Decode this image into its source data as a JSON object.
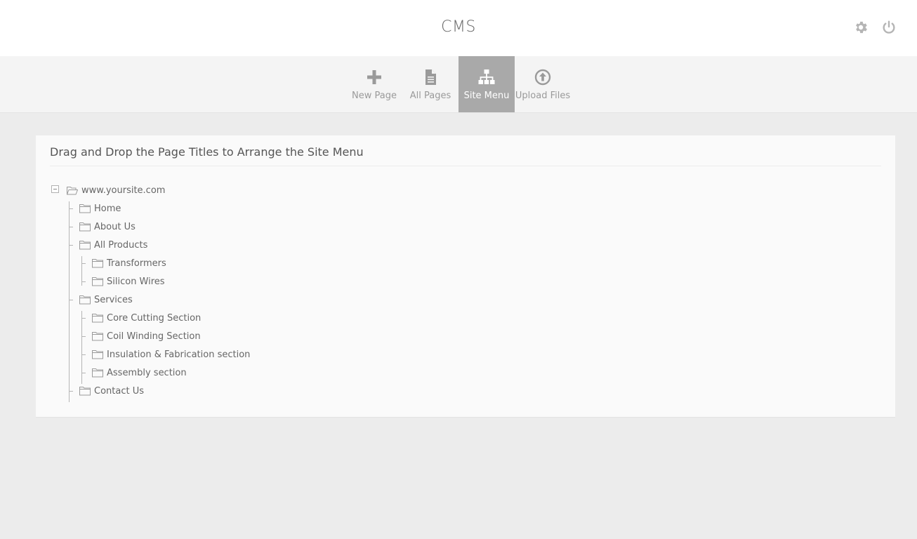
{
  "header": {
    "title": "CMS",
    "icons": [
      "gear-icon",
      "power-icon"
    ]
  },
  "toolbar": {
    "active": "Site Menu",
    "items": [
      {
        "label": "New Page",
        "icon": "plus-icon"
      },
      {
        "label": "All Pages",
        "icon": "document-icon"
      },
      {
        "label": "Site Menu",
        "icon": "sitemap-icon"
      },
      {
        "label": "Upload Files",
        "icon": "upload-icon"
      }
    ]
  },
  "panel": {
    "title": "Drag and Drop the Page Titles to Arrange the Site Menu",
    "tree": {
      "root": "www.yoursite.com",
      "items": [
        {
          "label": "Home"
        },
        {
          "label": "About Us"
        },
        {
          "label": "All Products",
          "children": [
            {
              "label": "Transformers"
            },
            {
              "label": "Silicon Wires"
            }
          ]
        },
        {
          "label": "Services",
          "children": [
            {
              "label": "Core Cutting Section"
            },
            {
              "label": "Coil Winding Section"
            },
            {
              "label": "Insulation & Fabrication section"
            },
            {
              "label": "Assembly section"
            }
          ]
        },
        {
          "label": "Contact Us"
        }
      ]
    }
  },
  "colors": {
    "active_tab_bg": "#a9a9a9",
    "background": "#ececec",
    "panel_bg": "#fafafa"
  }
}
